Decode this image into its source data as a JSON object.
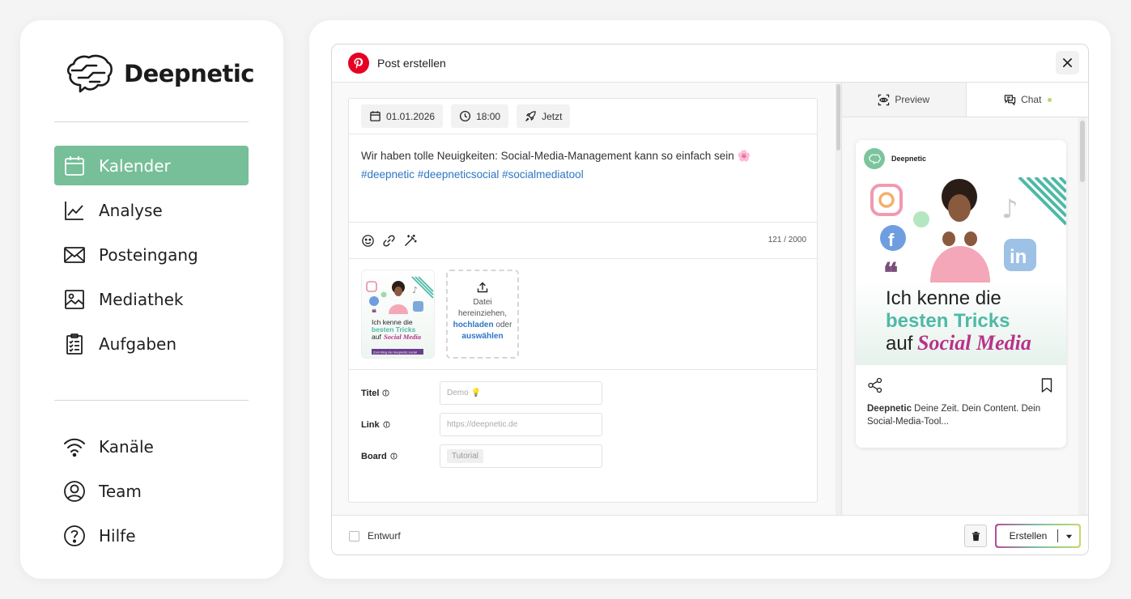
{
  "brand": {
    "name": "Deepnetic"
  },
  "sidebar": {
    "items": [
      {
        "label": "Kalender",
        "icon": "calendar-icon",
        "active": true
      },
      {
        "label": "Analyse",
        "icon": "chart-line-icon",
        "active": false
      },
      {
        "label": "Posteingang",
        "icon": "mail-icon",
        "active": false
      },
      {
        "label": "Mediathek",
        "icon": "image-icon",
        "active": false
      },
      {
        "label": "Aufgaben",
        "icon": "clipboard-list-icon",
        "active": false
      }
    ],
    "bottom_items": [
      {
        "label": "Kanäle",
        "icon": "wifi-icon"
      },
      {
        "label": "Team",
        "icon": "user-circle-icon"
      },
      {
        "label": "Hilfe",
        "icon": "help-circle-icon"
      }
    ]
  },
  "modal": {
    "title": "Post erstellen",
    "platform_icon": "pinterest-icon",
    "chips": {
      "date": "01.01.2026",
      "time": "18:00",
      "now": "Jetzt"
    },
    "post_text": "Wir haben tolle Neuigkeiten: Social-Media-Management kann so einfach sein 🌸",
    "post_hashtags": "#deepnetic #deepneticsocial #socialmediatool",
    "char_counter": "121 / 2000",
    "upload": {
      "line1": "Datei",
      "line2": "hereinziehen,",
      "upload_link": "hochladen",
      "or": "oder",
      "select_link": "auswählen"
    },
    "thumbnail": {
      "line1": "Ich kenne die",
      "line2": "besten Tricks",
      "line3a": "auf",
      "line3b": "Social Media",
      "banner": "Zum Blog der deepnetic social"
    },
    "fields": {
      "title_label": "Titel",
      "title_placeholder": "Demo 💡",
      "link_label": "Link",
      "link_placeholder": "https://deepnetic.de",
      "board_label": "Board",
      "board_value": "Tutorial"
    },
    "tabs": {
      "preview": "Preview",
      "chat": "Chat"
    },
    "preview_card": {
      "account": "Deepnetic",
      "image_line1": "Ich kenne die",
      "image_line2": "besten Tricks",
      "image_line3a": "auf",
      "image_line3b": "Social Media",
      "desc_bold": "Deepnetic",
      "desc_rest": " Deine Zeit. Dein Content. Dein Social-Media-Tool..."
    },
    "footer": {
      "draft_label": "Entwurf",
      "create_label": "Erstellen"
    }
  },
  "colors": {
    "accent_green": "#76bf98",
    "pinterest_red": "#e60023",
    "link_blue": "#2d76c4",
    "magenta": "#b8328a",
    "teal": "#4fb9a6"
  }
}
